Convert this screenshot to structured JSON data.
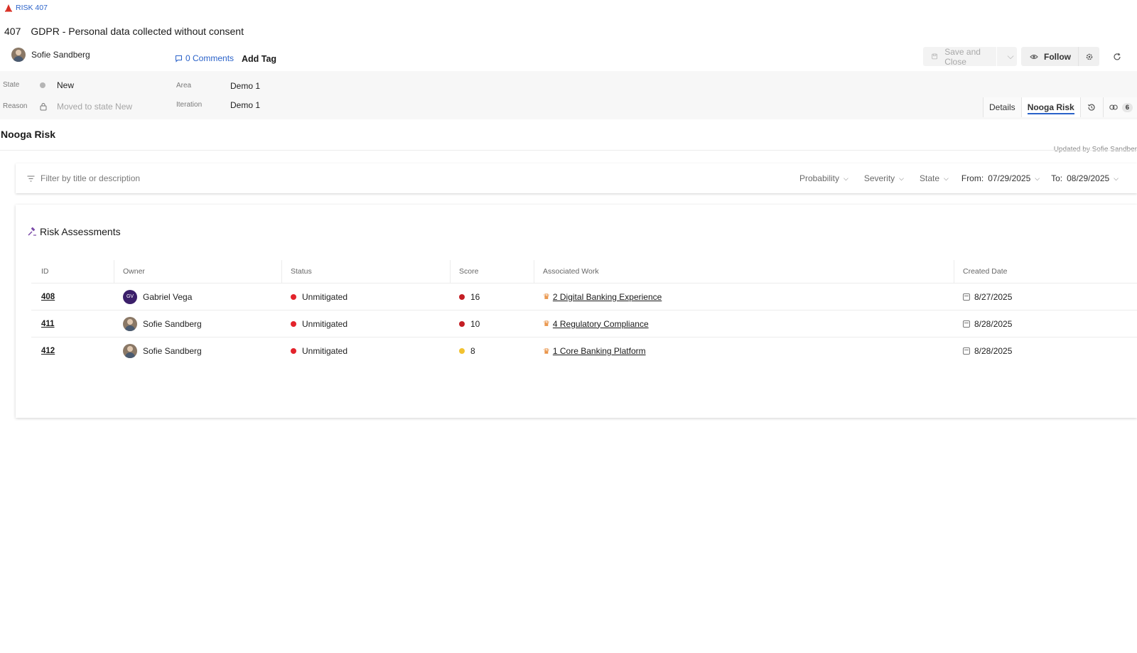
{
  "header": {
    "crumb": "RISK 407",
    "id": "407",
    "title": "GDPR - Personal data collected without consent",
    "owner": "Sofie Sandberg",
    "comments": "0 Comments",
    "add_tag": "Add Tag"
  },
  "toolbar": {
    "save_label": "Save and Close",
    "follow_label": "Follow",
    "updated_text": "Updated by Sofie Sandber"
  },
  "fields": {
    "state_label": "State",
    "state_value": "New",
    "reason_label": "Reason",
    "reason_value": "Moved to state New",
    "area_label": "Area",
    "area_value": "Demo 1",
    "iteration_label": "Iteration",
    "iteration_value": "Demo 1"
  },
  "tabs": {
    "details": "Details",
    "nooga": "Nooga Risk",
    "links_count": "6"
  },
  "section_title": "Nooga Risk",
  "filters": {
    "placeholder": "Filter by title or description",
    "probability": "Probability",
    "severity": "Severity",
    "state": "State",
    "from_label": "From:",
    "from_value": "07/29/2025",
    "to_label": "To:",
    "to_value": "08/29/2025"
  },
  "assessments": {
    "title": "Risk Assessments",
    "columns": [
      "ID",
      "Owner",
      "Status",
      "Score",
      "Associated Work",
      "Created Date"
    ],
    "rows": [
      {
        "id": "408",
        "owner": "Gabriel Vega",
        "owner_initials": "GV",
        "status": "Unmitigated",
        "score": "16",
        "score_color": "#c41e24",
        "work": "2 Digital Banking Experience",
        "date": "8/27/2025"
      },
      {
        "id": "411",
        "owner": "Sofie Sandberg",
        "status": "Unmitigated",
        "score": "10",
        "score_color": "#c41e24",
        "work": "4 Regulatory Compliance",
        "date": "8/28/2025"
      },
      {
        "id": "412",
        "owner": "Sofie Sandberg",
        "status": "Unmitigated",
        "score": "8",
        "score_color": "#f2c230",
        "work": "1 Core Banking Platform",
        "date": "8/28/2025"
      }
    ]
  },
  "colors": {
    "accent": "#2a62c9",
    "status_red": "#e3232b",
    "crown_orange": "#e2720f"
  }
}
